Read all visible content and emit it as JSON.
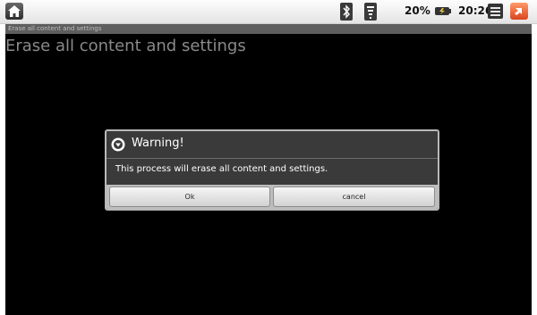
{
  "status_bar": {
    "battery_percent": "20%",
    "time": "20:26",
    "icons": [
      "home-icon",
      "bluetooth-icon",
      "wifi-icon",
      "battery-icon",
      "menu-icon",
      "back-icon"
    ]
  },
  "app": {
    "title_bar": "Erase all content and settings",
    "heading": "Erase all content and settings"
  },
  "dialog": {
    "title": "Warning!",
    "message": "This process will erase all content and settings.",
    "ok_label": "Ok",
    "cancel_label": "cancel"
  },
  "colors": {
    "background": "#000000",
    "dialog_bg": "#3a3a3a",
    "back_button": "#e8582a"
  }
}
